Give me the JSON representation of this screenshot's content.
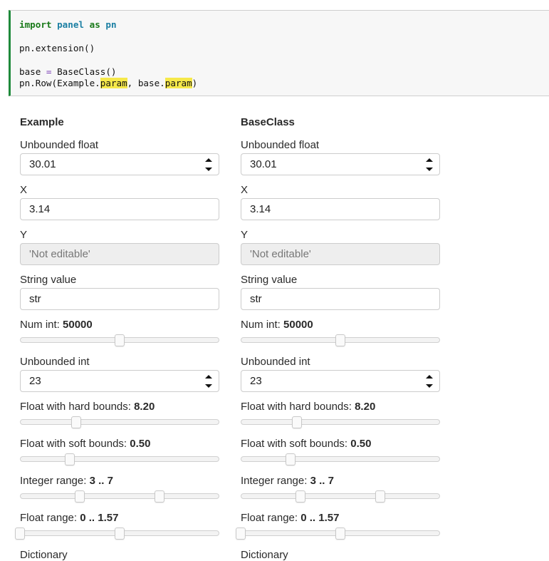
{
  "notebook": {
    "code": {
      "line1": {
        "import_kw": "import",
        "module": "panel",
        "as_kw": "as",
        "alias": "pn"
      },
      "line2": "pn.extension()",
      "line3": {
        "lhs": "base ",
        "eq": "=",
        "rhs": " BaseClass()"
      },
      "line4": {
        "prefix": "pn.Row(Example.",
        "hl1": "param",
        "mid": ", base.",
        "hl2": "param",
        "suffix": ")"
      }
    }
  },
  "panels": [
    {
      "title": "Example",
      "unbounded_float": {
        "label": "Unbounded float",
        "value": "30.01"
      },
      "x": {
        "label": "X",
        "value": "3.14"
      },
      "y": {
        "label": "Y",
        "value": "'Not editable'"
      },
      "string_value": {
        "label": "String value",
        "value": "str"
      },
      "num_int": {
        "label": "Num int: ",
        "value": "50000",
        "fraction": 0.5
      },
      "unbounded_int": {
        "label": "Unbounded int",
        "value": "23"
      },
      "float_hard": {
        "label": "Float with hard bounds: ",
        "value": "8.20",
        "fraction": 0.282
      },
      "float_soft": {
        "label": "Float with soft bounds: ",
        "value": "0.50",
        "fraction": 0.25
      },
      "integer_range": {
        "label": "Integer range: ",
        "value": "3 .. 7",
        "fraction_low": 0.3,
        "fraction_high": 0.7
      },
      "float_range": {
        "label": "Float range: ",
        "value": "0 .. 1.57",
        "fraction_low": 0.0,
        "fraction_high": 0.5
      },
      "dictionary": {
        "label": "Dictionary"
      }
    },
    {
      "title": "BaseClass",
      "unbounded_float": {
        "label": "Unbounded float",
        "value": "30.01"
      },
      "x": {
        "label": "X",
        "value": "3.14"
      },
      "y": {
        "label": "Y",
        "value": "'Not editable'"
      },
      "string_value": {
        "label": "String value",
        "value": "str"
      },
      "num_int": {
        "label": "Num int: ",
        "value": "50000",
        "fraction": 0.5
      },
      "unbounded_int": {
        "label": "Unbounded int",
        "value": "23"
      },
      "float_hard": {
        "label": "Float with hard bounds: ",
        "value": "8.20",
        "fraction": 0.282
      },
      "float_soft": {
        "label": "Float with soft bounds: ",
        "value": "0.50",
        "fraction": 0.25
      },
      "integer_range": {
        "label": "Integer range: ",
        "value": "3 .. 7",
        "fraction_low": 0.3,
        "fraction_high": 0.7
      },
      "float_range": {
        "label": "Float range: ",
        "value": "0 .. 1.57",
        "fraction_low": 0.0,
        "fraction_high": 0.5
      },
      "dictionary": {
        "label": "Dictionary"
      }
    }
  ],
  "colors": {
    "cell_accent": "#1f8a3b",
    "keyword": "#1a7a1a",
    "module": "#1b7fa3",
    "highlight": "#f6e94a",
    "disabled_bg": "#eeeeee"
  }
}
